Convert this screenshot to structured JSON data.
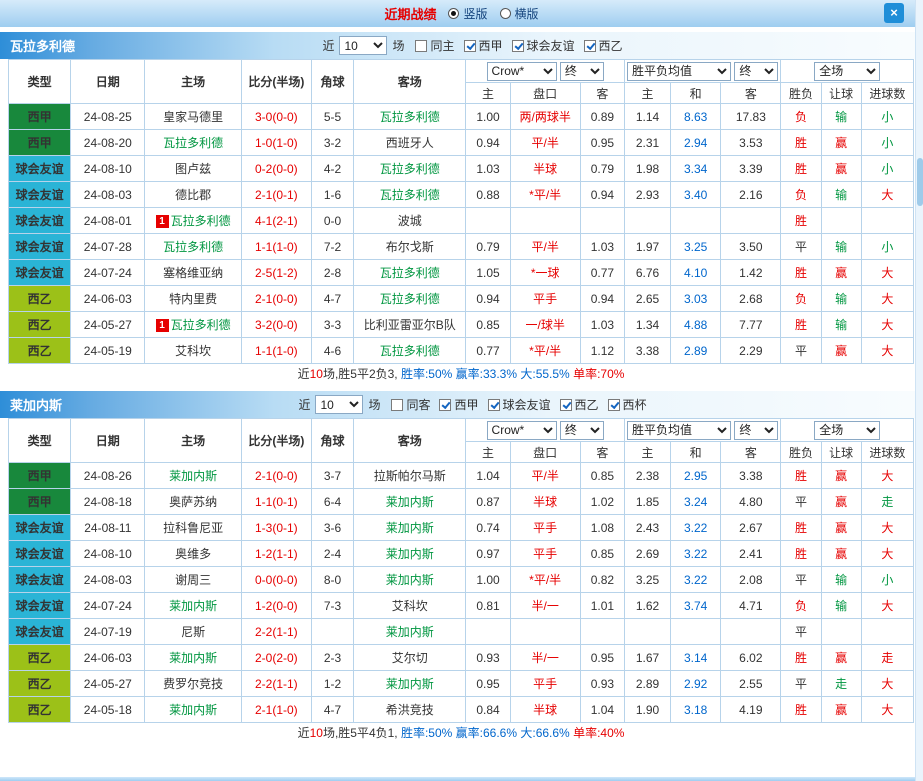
{
  "topbar": {
    "title": "近期战绩",
    "radios": [
      {
        "label": "竖版",
        "checked": true
      },
      {
        "label": "横版",
        "checked": false
      }
    ],
    "close_label": "×"
  },
  "colors": {
    "status": {
      "red": "#e60000",
      "green": "#009640",
      "blue": "#0066cc",
      "black": "#333333"
    },
    "leagues": {
      "西甲": "#18883c",
      "球会友谊": "#2ab4d6",
      "西乙": "#9cc118"
    },
    "focus_team": "#009640",
    "score": "#e60000",
    "handicap": "#e60000",
    "avg_draw": "#0066cc"
  },
  "sections": [
    {
      "team": "瓦拉多利德",
      "filter": {
        "near_label": "近",
        "games_value": "10",
        "games_label": "场",
        "checkboxes": [
          {
            "label": "同主",
            "checked": false
          },
          {
            "label": "西甲",
            "checked": true
          },
          {
            "label": "球会友谊",
            "checked": true
          },
          {
            "label": "西乙",
            "checked": true
          }
        ]
      },
      "selects": {
        "company": "Crow*",
        "company_state": "终",
        "avg": "胜平负均值",
        "avg_state": "终",
        "scope": "全场"
      },
      "headers": {
        "type": "类型",
        "date": "日期",
        "home": "主场",
        "score": "比分(半场)",
        "corner": "角球",
        "away": "客场",
        "odds_home": "主",
        "odds_handicap": "盘口",
        "odds_away": "客",
        "avg_home": "主",
        "avg_draw": "和",
        "avg_away": "客",
        "result": "胜负",
        "handicap_result": "让球",
        "goals": "进球数"
      },
      "rows": [
        {
          "league": "西甲",
          "date": "24-08-25",
          "home": {
            "name": "皇家马德里",
            "focus": false,
            "badge": ""
          },
          "score": "3-0(0-0)",
          "corner": "5-5",
          "away": {
            "name": "瓦拉多利德",
            "focus": true,
            "badge": ""
          },
          "odds": [
            "1.00",
            "两/两球半",
            "0.89"
          ],
          "avg": [
            "1.14",
            "8.63",
            "17.83"
          ],
          "result": [
            "负",
            "red"
          ],
          "handicap": [
            "输",
            "green"
          ],
          "goal": [
            "小",
            "green"
          ]
        },
        {
          "league": "西甲",
          "date": "24-08-20",
          "home": {
            "name": "瓦拉多利德",
            "focus": true,
            "badge": ""
          },
          "score": "1-0(1-0)",
          "corner": "3-2",
          "away": {
            "name": "西班牙人",
            "focus": false,
            "badge": ""
          },
          "odds": [
            "0.94",
            "平/半",
            "0.95"
          ],
          "avg": [
            "2.31",
            "2.94",
            "3.53"
          ],
          "result": [
            "胜",
            "red"
          ],
          "handicap": [
            "赢",
            "red"
          ],
          "goal": [
            "小",
            "green"
          ]
        },
        {
          "league": "球会友谊",
          "date": "24-08-10",
          "home": {
            "name": "图卢兹",
            "focus": false,
            "badge": ""
          },
          "score": "0-2(0-0)",
          "corner": "4-2",
          "away": {
            "name": "瓦拉多利德",
            "focus": true,
            "badge": ""
          },
          "odds": [
            "1.03",
            "半球",
            "0.79"
          ],
          "avg": [
            "1.98",
            "3.34",
            "3.39"
          ],
          "result": [
            "胜",
            "red"
          ],
          "handicap": [
            "赢",
            "red"
          ],
          "goal": [
            "小",
            "green"
          ]
        },
        {
          "league": "球会友谊",
          "date": "24-08-03",
          "home": {
            "name": "德比郡",
            "focus": false,
            "badge": ""
          },
          "score": "2-1(0-1)",
          "corner": "1-6",
          "away": {
            "name": "瓦拉多利德",
            "focus": true,
            "badge": ""
          },
          "odds": [
            "0.88",
            "*平/半",
            "0.94"
          ],
          "avg": [
            "2.93",
            "3.40",
            "2.16"
          ],
          "result": [
            "负",
            "red"
          ],
          "handicap": [
            "输",
            "green"
          ],
          "goal": [
            "大",
            "red"
          ]
        },
        {
          "league": "球会友谊",
          "date": "24-08-01",
          "home": {
            "name": "瓦拉多利德",
            "focus": true,
            "badge": "1"
          },
          "score": "4-1(2-1)",
          "corner": "0-0",
          "away": {
            "name": "波城",
            "focus": false,
            "badge": ""
          },
          "odds": [
            "",
            "",
            ""
          ],
          "avg": [
            "",
            "",
            ""
          ],
          "result": [
            "胜",
            "red"
          ],
          "handicap": [
            "",
            ""
          ],
          "goal": [
            "",
            ""
          ]
        },
        {
          "league": "球会友谊",
          "date": "24-07-28",
          "home": {
            "name": "瓦拉多利德",
            "focus": true,
            "badge": ""
          },
          "score": "1-1(1-0)",
          "corner": "7-2",
          "away": {
            "name": "布尔戈斯",
            "focus": false,
            "badge": ""
          },
          "odds": [
            "0.79",
            "平/半",
            "1.03"
          ],
          "avg": [
            "1.97",
            "3.25",
            "3.50"
          ],
          "result": [
            "平",
            "black"
          ],
          "handicap": [
            "输",
            "green"
          ],
          "goal": [
            "小",
            "green"
          ]
        },
        {
          "league": "球会友谊",
          "date": "24-07-24",
          "home": {
            "name": "塞格维亚纳",
            "focus": false,
            "badge": ""
          },
          "score": "2-5(1-2)",
          "corner": "2-8",
          "away": {
            "name": "瓦拉多利德",
            "focus": true,
            "badge": ""
          },
          "odds": [
            "1.05",
            "*一球",
            "0.77"
          ],
          "avg": [
            "6.76",
            "4.10",
            "1.42"
          ],
          "result": [
            "胜",
            "red"
          ],
          "handicap": [
            "赢",
            "red"
          ],
          "goal": [
            "大",
            "red"
          ]
        },
        {
          "league": "西乙",
          "date": "24-06-03",
          "home": {
            "name": "特内里费",
            "focus": false,
            "badge": ""
          },
          "score": "2-1(0-0)",
          "corner": "4-7",
          "away": {
            "name": "瓦拉多利德",
            "focus": true,
            "badge": ""
          },
          "odds": [
            "0.94",
            "平手",
            "0.94"
          ],
          "avg": [
            "2.65",
            "3.03",
            "2.68"
          ],
          "result": [
            "负",
            "red"
          ],
          "handicap": [
            "输",
            "green"
          ],
          "goal": [
            "大",
            "red"
          ]
        },
        {
          "league": "西乙",
          "date": "24-05-27",
          "home": {
            "name": "瓦拉多利德",
            "focus": true,
            "badge": "1"
          },
          "score": "3-2(0-0)",
          "corner": "3-3",
          "away": {
            "name": "比利亚雷亚尔B队",
            "focus": false,
            "badge": ""
          },
          "odds": [
            "0.85",
            "一/球半",
            "1.03"
          ],
          "avg": [
            "1.34",
            "4.88",
            "7.77"
          ],
          "result": [
            "胜",
            "red"
          ],
          "handicap": [
            "输",
            "green"
          ],
          "goal": [
            "大",
            "red"
          ]
        },
        {
          "league": "西乙",
          "date": "24-05-19",
          "home": {
            "name": "艾科坎",
            "focus": false,
            "badge": ""
          },
          "score": "1-1(1-0)",
          "corner": "4-6",
          "away": {
            "name": "瓦拉多利德",
            "focus": true,
            "badge": ""
          },
          "odds": [
            "0.77",
            "*平/半",
            "1.12"
          ],
          "avg": [
            "3.38",
            "2.89",
            "2.29"
          ],
          "result": [
            "平",
            "black"
          ],
          "handicap": [
            "赢",
            "red"
          ],
          "goal": [
            "大",
            "red"
          ]
        }
      ],
      "footer_parts": [
        {
          "text": "近",
          "color": "black"
        },
        {
          "text": "10",
          "color": "red"
        },
        {
          "text": "场,胜5平2负3, ",
          "color": "black"
        },
        {
          "text": "胜率:50% ",
          "color": "blue"
        },
        {
          "text": "赢率:33.3% ",
          "color": "blue"
        },
        {
          "text": "大:55.5% ",
          "color": "blue"
        },
        {
          "text": "单率:70%",
          "color": "red"
        }
      ]
    },
    {
      "team": "莱加内斯",
      "filter": {
        "near_label": "近",
        "games_value": "10",
        "games_label": "场",
        "checkboxes": [
          {
            "label": "同客",
            "checked": false
          },
          {
            "label": "西甲",
            "checked": true
          },
          {
            "label": "球会友谊",
            "checked": true
          },
          {
            "label": "西乙",
            "checked": true
          },
          {
            "label": "西杯",
            "checked": true
          }
        ]
      },
      "selects": {
        "company": "Crow*",
        "company_state": "终",
        "avg": "胜平负均值",
        "avg_state": "终",
        "scope": "全场"
      },
      "headers": {
        "type": "类型",
        "date": "日期",
        "home": "主场",
        "score": "比分(半场)",
        "corner": "角球",
        "away": "客场",
        "odds_home": "主",
        "odds_handicap": "盘口",
        "odds_away": "客",
        "avg_home": "主",
        "avg_draw": "和",
        "avg_away": "客",
        "result": "胜负",
        "handicap_result": "让球",
        "goals": "进球数"
      },
      "rows": [
        {
          "league": "西甲",
          "date": "24-08-26",
          "home": {
            "name": "莱加内斯",
            "focus": true,
            "badge": ""
          },
          "score": "2-1(0-0)",
          "corner": "3-7",
          "away": {
            "name": "拉斯帕尔马斯",
            "focus": false,
            "badge": ""
          },
          "odds": [
            "1.04",
            "平/半",
            "0.85"
          ],
          "avg": [
            "2.38",
            "2.95",
            "3.38"
          ],
          "result": [
            "胜",
            "red"
          ],
          "handicap": [
            "赢",
            "red"
          ],
          "goal": [
            "大",
            "red"
          ]
        },
        {
          "league": "西甲",
          "date": "24-08-18",
          "home": {
            "name": "奥萨苏纳",
            "focus": false,
            "badge": ""
          },
          "score": "1-1(0-1)",
          "corner": "6-4",
          "away": {
            "name": "莱加内斯",
            "focus": true,
            "badge": ""
          },
          "odds": [
            "0.87",
            "半球",
            "1.02"
          ],
          "avg": [
            "1.85",
            "3.24",
            "4.80"
          ],
          "result": [
            "平",
            "black"
          ],
          "handicap": [
            "赢",
            "red"
          ],
          "goal": [
            "走",
            "green"
          ]
        },
        {
          "league": "球会友谊",
          "date": "24-08-11",
          "home": {
            "name": "拉科鲁尼亚",
            "focus": false,
            "badge": ""
          },
          "score": "1-3(0-1)",
          "corner": "3-6",
          "away": {
            "name": "莱加内斯",
            "focus": true,
            "badge": ""
          },
          "odds": [
            "0.74",
            "平手",
            "1.08"
          ],
          "avg": [
            "2.43",
            "3.22",
            "2.67"
          ],
          "result": [
            "胜",
            "red"
          ],
          "handicap": [
            "赢",
            "red"
          ],
          "goal": [
            "大",
            "red"
          ]
        },
        {
          "league": "球会友谊",
          "date": "24-08-10",
          "home": {
            "name": "奥维多",
            "focus": false,
            "badge": ""
          },
          "score": "1-2(1-1)",
          "corner": "2-4",
          "away": {
            "name": "莱加内斯",
            "focus": true,
            "badge": ""
          },
          "odds": [
            "0.97",
            "平手",
            "0.85"
          ],
          "avg": [
            "2.69",
            "3.22",
            "2.41"
          ],
          "result": [
            "胜",
            "red"
          ],
          "handicap": [
            "赢",
            "red"
          ],
          "goal": [
            "大",
            "red"
          ]
        },
        {
          "league": "球会友谊",
          "date": "24-08-03",
          "home": {
            "name": "谢周三",
            "focus": false,
            "badge": ""
          },
          "score": "0-0(0-0)",
          "corner": "8-0",
          "away": {
            "name": "莱加内斯",
            "focus": true,
            "badge": ""
          },
          "odds": [
            "1.00",
            "*平/半",
            "0.82"
          ],
          "avg": [
            "3.25",
            "3.22",
            "2.08"
          ],
          "result": [
            "平",
            "black"
          ],
          "handicap": [
            "输",
            "green"
          ],
          "goal": [
            "小",
            "green"
          ]
        },
        {
          "league": "球会友谊",
          "date": "24-07-24",
          "home": {
            "name": "莱加内斯",
            "focus": true,
            "badge": ""
          },
          "score": "1-2(0-0)",
          "corner": "7-3",
          "away": {
            "name": "艾科坎",
            "focus": false,
            "badge": ""
          },
          "odds": [
            "0.81",
            "半/一",
            "1.01"
          ],
          "avg": [
            "1.62",
            "3.74",
            "4.71"
          ],
          "result": [
            "负",
            "red"
          ],
          "handicap": [
            "输",
            "green"
          ],
          "goal": [
            "大",
            "red"
          ]
        },
        {
          "league": "球会友谊",
          "date": "24-07-19",
          "home": {
            "name": "尼斯",
            "focus": false,
            "badge": ""
          },
          "score": "2-2(1-1)",
          "corner": "",
          "away": {
            "name": "莱加内斯",
            "focus": true,
            "badge": ""
          },
          "odds": [
            "",
            "",
            ""
          ],
          "avg": [
            "",
            "",
            ""
          ],
          "result": [
            "平",
            "black"
          ],
          "handicap": [
            "",
            ""
          ],
          "goal": [
            "",
            ""
          ]
        },
        {
          "league": "西乙",
          "date": "24-06-03",
          "home": {
            "name": "莱加内斯",
            "focus": true,
            "badge": ""
          },
          "score": "2-0(2-0)",
          "corner": "2-3",
          "away": {
            "name": "艾尔切",
            "focus": false,
            "badge": ""
          },
          "odds": [
            "0.93",
            "半/一",
            "0.95"
          ],
          "avg": [
            "1.67",
            "3.14",
            "6.02"
          ],
          "result": [
            "胜",
            "red"
          ],
          "handicap": [
            "赢",
            "red"
          ],
          "goal": [
            "走",
            "red"
          ]
        },
        {
          "league": "西乙",
          "date": "24-05-27",
          "home": {
            "name": "费罗尔竞技",
            "focus": false,
            "badge": ""
          },
          "score": "2-2(1-1)",
          "corner": "1-2",
          "away": {
            "name": "莱加内斯",
            "focus": true,
            "badge": ""
          },
          "odds": [
            "0.95",
            "平手",
            "0.93"
          ],
          "avg": [
            "2.89",
            "2.92",
            "2.55"
          ],
          "result": [
            "平",
            "black"
          ],
          "handicap": [
            "走",
            "green"
          ],
          "goal": [
            "大",
            "red"
          ]
        },
        {
          "league": "西乙",
          "date": "24-05-18",
          "home": {
            "name": "莱加内斯",
            "focus": true,
            "badge": ""
          },
          "score": "2-1(1-0)",
          "corner": "4-7",
          "away": {
            "name": "希洪竞技",
            "focus": false,
            "badge": ""
          },
          "odds": [
            "0.84",
            "半球",
            "1.04"
          ],
          "avg": [
            "1.90",
            "3.18",
            "4.19"
          ],
          "result": [
            "胜",
            "red"
          ],
          "handicap": [
            "赢",
            "red"
          ],
          "goal": [
            "大",
            "red"
          ]
        }
      ],
      "footer_parts": [
        {
          "text": "近",
          "color": "black"
        },
        {
          "text": "10",
          "color": "red"
        },
        {
          "text": "场,胜5平4负1, ",
          "color": "black"
        },
        {
          "text": "胜率:50% ",
          "color": "blue"
        },
        {
          "text": "赢率:66.6% ",
          "color": "blue"
        },
        {
          "text": "大:66.6% ",
          "color": "blue"
        },
        {
          "text": "单率:40%",
          "color": "red"
        }
      ]
    }
  ]
}
